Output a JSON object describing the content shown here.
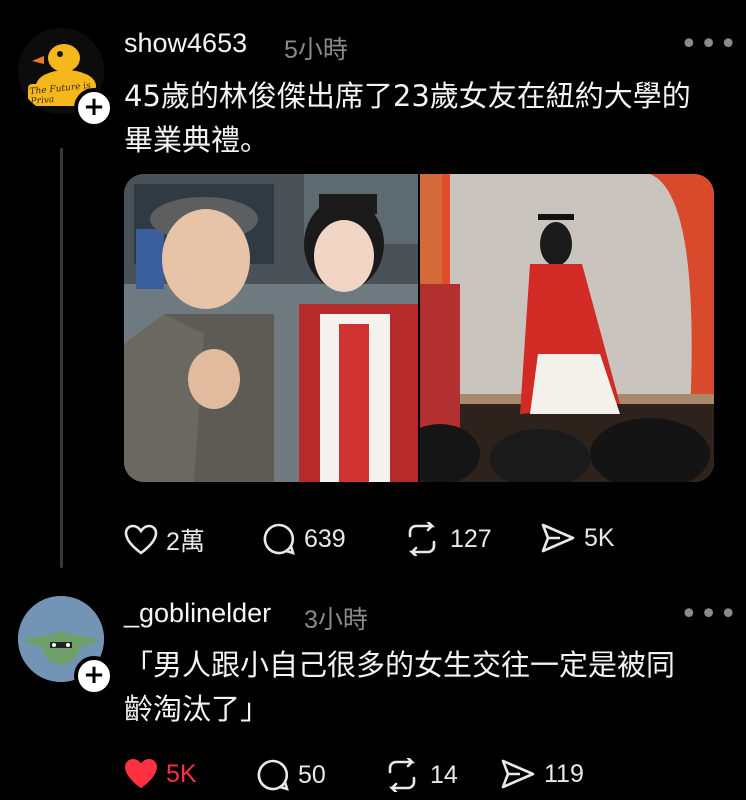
{
  "posts": [
    {
      "username": "show4653",
      "time": "5小時",
      "avatar_text": "The Future is Priva",
      "text_line1": "45歲的林俊傑出席了23歲女友在紐約大學的",
      "text_line2": "畢業典禮。",
      "actions": {
        "likes": "2萬",
        "comments": "639",
        "reposts": "127",
        "shares": "5K"
      }
    },
    {
      "username": "_goblinelder",
      "time": "3小時",
      "text_line1": "「男人跟小自己很多的女生交往一定是被同",
      "text_line2": "齡淘汰了」",
      "actions": {
        "likes": "5K",
        "comments": "50",
        "reposts": "14",
        "shares": "119"
      }
    }
  ],
  "colors": {
    "background": "#000000",
    "like_active": "#ff3040",
    "muted": "#8a8a8a"
  }
}
